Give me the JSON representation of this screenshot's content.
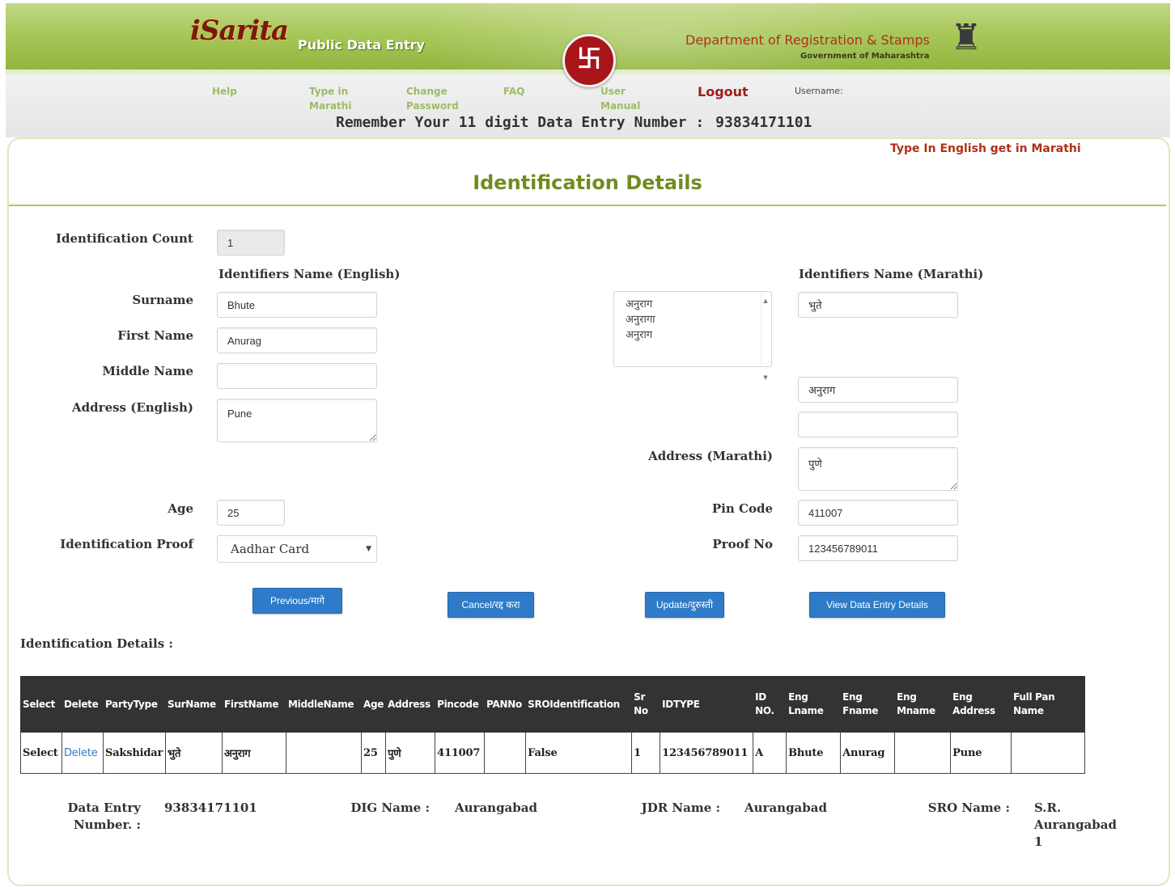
{
  "header": {
    "logo_text": "iSarita",
    "logo_subtitle": "Public Data Entry",
    "department": "Department of Registration & Stamps",
    "government": "Government of Maharashtra"
  },
  "nav": {
    "help": "Help",
    "type_in_marathi": "Type in Marathi",
    "change_password": "Change Password",
    "faq": "FAQ",
    "user_manual": "User Manual",
    "logout": "Logout",
    "username_label": "Username:"
  },
  "reminder": {
    "text": "Remember Your 11 digit Data Entry Number :",
    "number": "93834171101"
  },
  "type_hint": "Type In English get in Marathi",
  "page_title": "Identification Details",
  "form": {
    "identification_count_label": "Identification Count",
    "identification_count_value": "1",
    "english_heading": "Identifiers Name (English)",
    "marathi_heading": "Identifiers Name (Marathi)",
    "surname_label": "Surname",
    "surname_value": "Bhute",
    "first_name_label": "First Name",
    "first_name_value": "Anurag",
    "middle_name_label": "Middle Name",
    "middle_name_value": "",
    "address_en_label": "Address (English)",
    "address_en_value": "Pune",
    "marathi_surname_value": "भुते",
    "suggestions": [
      "अनुराग",
      "अनुरागा",
      "अनुराग"
    ],
    "marathi_first_name_value": "अनुराग",
    "marathi_middle_name_value": "",
    "address_mr_label": "Address (Marathi)",
    "address_mr_value": "पुणे",
    "age_label": "Age",
    "age_value": "25",
    "pin_code_label": "Pin Code",
    "pin_code_value": "411007",
    "id_proof_label": "Identification Proof",
    "id_proof_value": "Aadhar Card",
    "proof_no_label": "Proof No",
    "proof_no_value": "123456789011"
  },
  "buttons": {
    "previous": "Previous/मागे",
    "cancel": "Cancel/रद्द करा",
    "update": "Update/दुरुस्ती",
    "view_details": "View Data Entry Details"
  },
  "table": {
    "heading": "Identification Details :",
    "columns": [
      "Select",
      "Delete",
      "PartyType",
      "SurName",
      "FirstName",
      "MiddleName",
      "Age",
      "Address",
      "Pincode",
      "PANNo",
      "SROIdentification",
      "Sr No",
      "IDTYPE",
      "ID NO.",
      "Eng Lname",
      "Eng Fname",
      "Eng Mname",
      "Eng Address",
      "Full Pan Name"
    ],
    "rows": [
      [
        "Select",
        "Delete",
        "Sakshidar",
        "भुते",
        "अनुराग",
        "",
        "25",
        "पुणे",
        "411007",
        "",
        "False",
        "1",
        "123456789011",
        "A",
        "Bhute",
        "Anurag",
        "",
        "Pune",
        ""
      ]
    ]
  },
  "footer": {
    "data_entry_label": "Data Entry Number. :",
    "data_entry_value": "93834171101",
    "dig_label": "DIG Name :",
    "dig_value": "Aurangabad",
    "jdr_label": "JDR Name :",
    "jdr_value": "Aurangabad",
    "sro_label": "SRO Name :",
    "sro_value": "S.R. Aurangabad 1"
  },
  "colors": {
    "header_green": "#a9c85b",
    "title_green": "#6e8d1e",
    "accent_red": "#b03018",
    "button_blue": "#2f7bc9",
    "table_header": "#333333"
  }
}
